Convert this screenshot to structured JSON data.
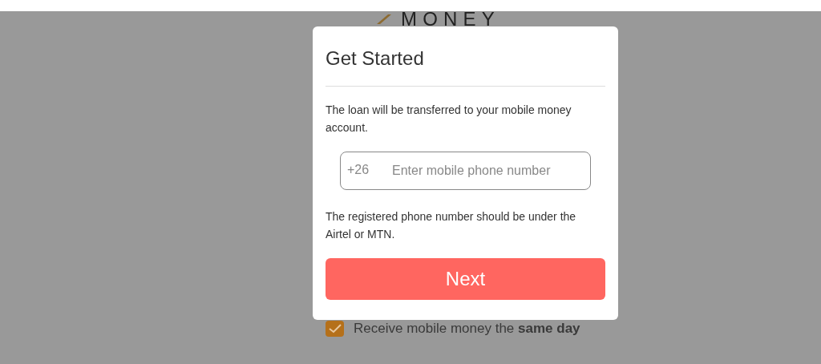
{
  "logo": {
    "text": "MONEY"
  },
  "dialog": {
    "title": "Get Started",
    "intro": "The loan will be transferred to your mobile money account.",
    "phone_field": {
      "prefix": "+26",
      "placeholder": "Enter mobile phone number"
    },
    "note": "The registered phone number should be under the Airtel or MTN.",
    "next_button": "Next"
  },
  "feature": {
    "checked": true,
    "text": "Receive mobile money the **same day**"
  }
}
